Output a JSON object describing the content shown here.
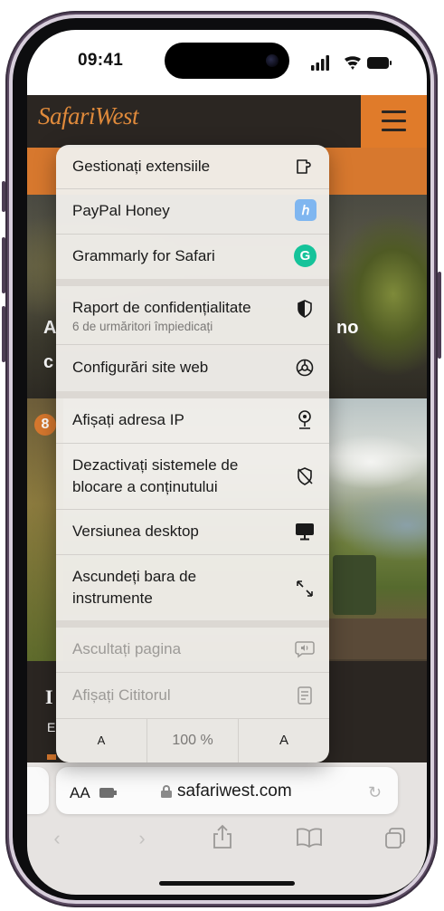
{
  "status_bar": {
    "time": "09:41"
  },
  "site": {
    "logo": "SafariWest",
    "hero_fragment_left": "A",
    "hero_fragment_left_2": "c",
    "hero_fragment_right": "no",
    "dark_heading_fragment": "I",
    "dark_sub_fragment": "E",
    "badge_glyph": "8"
  },
  "menu": {
    "items": [
      {
        "label": "Gestionați extensiile",
        "icon": "extension-icon"
      },
      {
        "label": "PayPal Honey",
        "icon": "paypal-honey-icon"
      },
      {
        "label": "Grammarly for Safari",
        "icon": "grammarly-icon"
      },
      {
        "label": "Raport de confidențialitate",
        "sublabel": "6 de urmăritori împiedicați",
        "icon": "privacy-shield-icon"
      },
      {
        "label": "Configurări site web",
        "icon": "website-settings-icon"
      },
      {
        "label": "Afișați adresa IP",
        "icon": "location-pin-icon"
      },
      {
        "label": "Dezactivați sistemele de",
        "label_line2": "blocare a conținutului",
        "icon": "blocker-off-icon"
      },
      {
        "label": "Versiunea desktop",
        "icon": "desktop-icon"
      },
      {
        "label": "Ascundeți bara de",
        "label_line2": "instrumente",
        "icon": "resize-arrows-icon"
      },
      {
        "label": "Ascultați pagina",
        "icon": "speech-bubble-icon",
        "disabled": true
      },
      {
        "label": "Afișați Cititorul",
        "icon": "reader-icon",
        "disabled": true
      }
    ],
    "zoom": {
      "decrease": "A",
      "level": "100 %",
      "increase": "A"
    }
  },
  "address_bar": {
    "aa": "AA",
    "url": "safariwest.com"
  },
  "colors": {
    "brand_orange": "#d7782e",
    "header_dark": "#2b2622",
    "honey_blue": "#7fb6f0",
    "grammarly_green": "#15c39a"
  }
}
